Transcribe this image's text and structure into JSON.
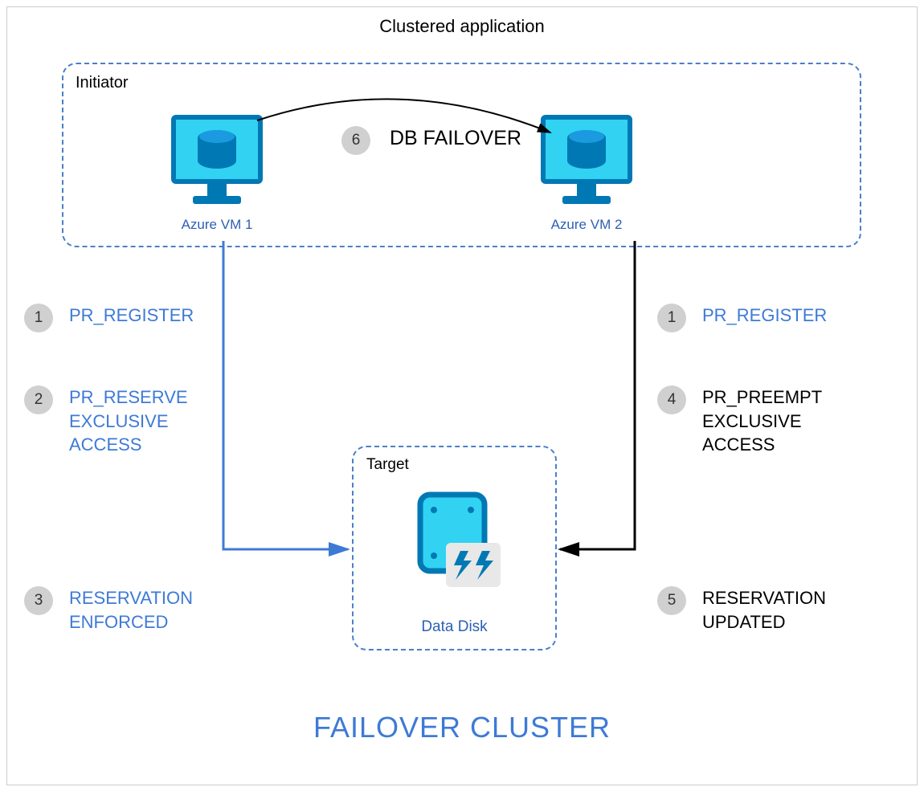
{
  "title": "Clustered application",
  "initiator_label": "Initiator",
  "vm1_label": "Azure VM 1",
  "vm2_label": "Azure VM 2",
  "failover": {
    "num": "6",
    "text": "DB FAILOVER"
  },
  "left_steps": {
    "s1": {
      "num": "1",
      "text": "PR_REGISTER"
    },
    "s2": {
      "num": "2",
      "text": "PR_RESERVE\nEXCLUSIVE\nACCESS"
    },
    "s3": {
      "num": "3",
      "text": "RESERVATION\nENFORCED"
    }
  },
  "right_steps": {
    "s1": {
      "num": "1",
      "text": "PR_REGISTER"
    },
    "s4": {
      "num": "4",
      "text": "PR_PREEMPT\nEXCLUSIVE\nACCESS"
    },
    "s5": {
      "num": "5",
      "text": "RESERVATION\nUPDATED"
    }
  },
  "target_label": "Target",
  "disk_label": "Data Disk",
  "bottom_title": "FAILOVER CLUSTER",
  "colors": {
    "azure_blue": "#0099dc",
    "azure_cyan": "#32d2f2",
    "text_blue": "#3d7ad6",
    "link_blue": "#2c5fb5"
  }
}
